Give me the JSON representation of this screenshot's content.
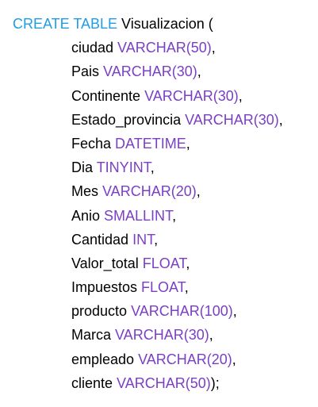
{
  "colors": {
    "keyword_blue": "#1f9de6",
    "type_purple": "#7b3fc4",
    "text": "#000000"
  },
  "sql": {
    "header": {
      "keyword": "CREATE TABLE",
      "table_name": " Visualizacion ("
    },
    "columns": [
      {
        "name": "ciudad ",
        "type": "VARCHAR(50)",
        "suffix": ","
      },
      {
        "name": "Pais ",
        "type": "VARCHAR(30)",
        "suffix": ","
      },
      {
        "name": "Continente ",
        "type": "VARCHAR(30)",
        "suffix": ","
      },
      {
        "name": "Estado_provincia ",
        "type": "VARCHAR(30)",
        "suffix": ","
      },
      {
        "name": "Fecha ",
        "type": "DATETIME",
        "suffix": ","
      },
      {
        "name": "Dia ",
        "type": "TINYINT",
        "suffix": ","
      },
      {
        "name": "Mes ",
        "type": "VARCHAR(20)",
        "suffix": ","
      },
      {
        "name": "Anio ",
        "type": "SMALLINT",
        "suffix": ","
      },
      {
        "name": "Cantidad ",
        "type": "INT",
        "suffix": ","
      },
      {
        "name": "Valor_total ",
        "type": "FLOAT",
        "suffix": ","
      },
      {
        "name": "Impuestos ",
        "type": "FLOAT",
        "suffix": ","
      },
      {
        "name": "producto ",
        "type": "VARCHAR(100)",
        "suffix": ","
      },
      {
        "name": "Marca ",
        "type": "VARCHAR(30)",
        "suffix": ","
      },
      {
        "name": "empleado ",
        "type": "VARCHAR(20)",
        "suffix": ","
      },
      {
        "name": "cliente ",
        "type": "VARCHAR(50)",
        "suffix": ");"
      }
    ]
  }
}
